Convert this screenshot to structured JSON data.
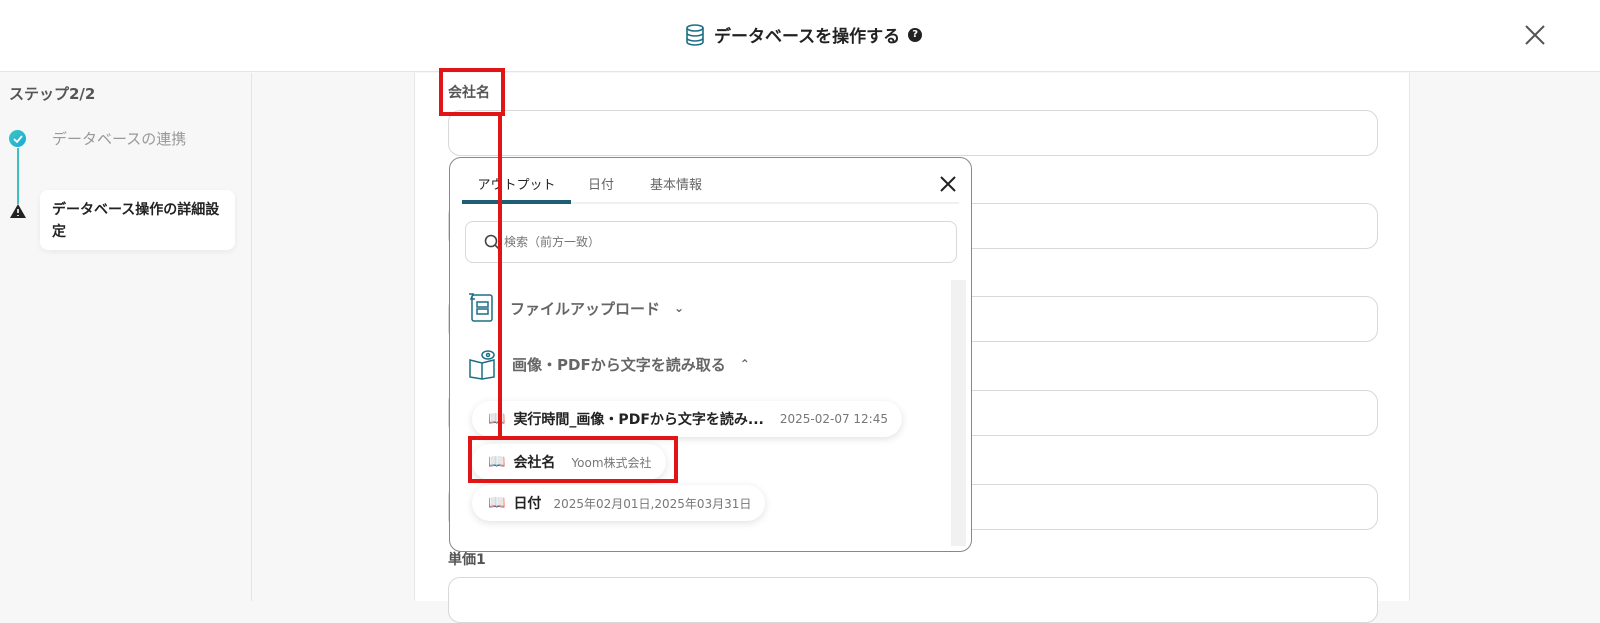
{
  "header": {
    "title": "データベースを操作する",
    "help_icon": "?"
  },
  "sidebar": {
    "step_title": "ステップ2/2",
    "steps": [
      {
        "label": "データベースの連携",
        "status": "done"
      },
      {
        "label": "データベース操作の詳細設定",
        "status": "warning"
      }
    ]
  },
  "form": {
    "fields": [
      {
        "label": "会社名"
      },
      {
        "label": "単価1"
      }
    ]
  },
  "popup": {
    "tabs": [
      "アウトプット",
      "日付",
      "基本情報"
    ],
    "search_placeholder": "検索（前方一致）",
    "groups": [
      {
        "label": "ファイルアップロード",
        "expanded": false
      },
      {
        "label": "画像・PDFから文字を読み取る",
        "expanded": true
      }
    ],
    "items": [
      {
        "key": "実行時間_画像・PDFから文字を読み...",
        "value": "2025-02-07 12:45"
      },
      {
        "key": "会社名",
        "value": "Yoom株式会社"
      },
      {
        "key": "日付",
        "value": "2025年02月01日,2025年03月31日"
      }
    ]
  },
  "colors": {
    "accent": "#1d5e74",
    "highlight": "#e01616",
    "teal": "#3fc0c0"
  }
}
